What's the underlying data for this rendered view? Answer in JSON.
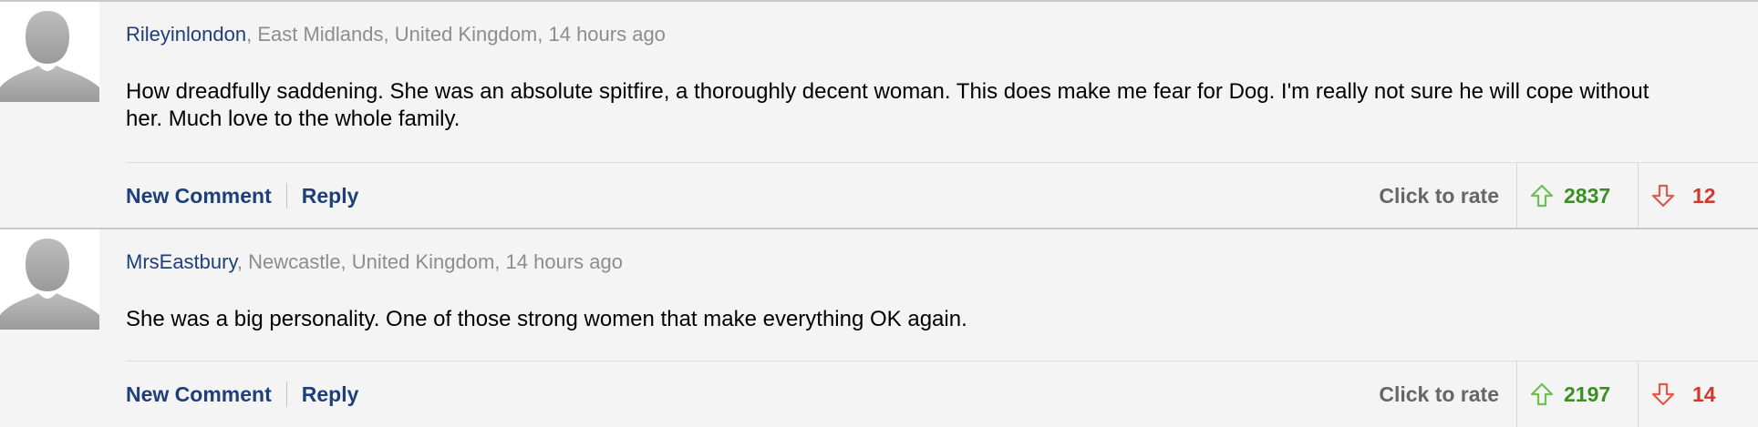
{
  "comments": [
    {
      "username": "Rileyinlondon",
      "location_time": ", East Midlands, United Kingdom, 14 hours ago",
      "body": "How dreadfully saddening. She was an absolute spitfire, a thoroughly decent woman. This does make me fear for Dog. I'm really not sure he will cope without her. Much love to the whole family.",
      "new_comment_label": "New Comment",
      "reply_label": "Reply",
      "rate_label": "Click to rate",
      "upvotes": "2837",
      "downvotes": "12"
    },
    {
      "username": "MrsEastbury",
      "location_time": ", Newcastle, United Kingdom, 14 hours ago",
      "body": "She was a big personality. One of those strong women that make everything OK again.",
      "new_comment_label": "New Comment",
      "reply_label": "Reply",
      "rate_label": "Click to rate",
      "upvotes": "2197",
      "downvotes": "14"
    }
  ],
  "icons": {
    "avatar": "default-avatar-icon",
    "upvote": "arrow-up-icon",
    "downvote": "arrow-down-icon"
  },
  "colors": {
    "username": "#1f3f7a",
    "upvote": "#3a8f25",
    "downvote": "#d2392c",
    "meta": "#8d8d8d",
    "rate_label": "#666666",
    "background": "#f4f4f4"
  }
}
